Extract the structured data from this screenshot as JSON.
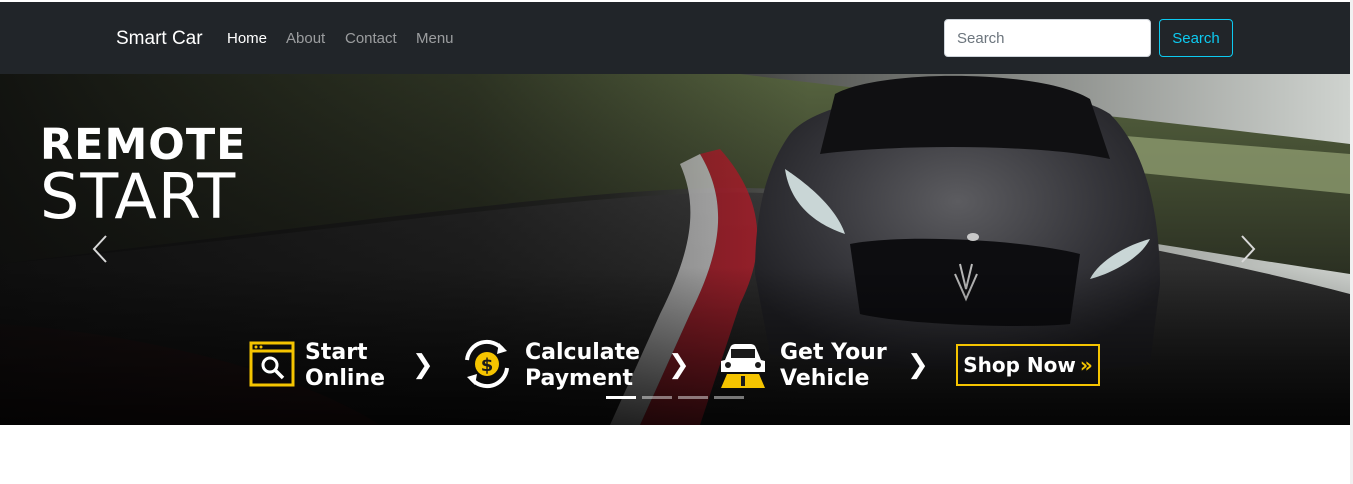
{
  "navbar": {
    "brand": "Smart Car",
    "links": [
      {
        "label": "Home",
        "active": true
      },
      {
        "label": "About",
        "active": false
      },
      {
        "label": "Contact",
        "active": false
      },
      {
        "label": "Menu",
        "active": false
      }
    ],
    "search": {
      "placeholder": "Search",
      "value": "",
      "button_label": "Search"
    }
  },
  "carousel": {
    "slide": {
      "headline_top": "REMOTE",
      "headline_bottom": "START",
      "steps": [
        {
          "line1": "Start",
          "line2": "Online",
          "icon": "browser-search-icon"
        },
        {
          "line1": "Calculate",
          "line2": "Payment",
          "icon": "dollar-cycle-icon"
        },
        {
          "line1": "Get Your",
          "line2": "Vehicle",
          "icon": "car-road-icon"
        }
      ],
      "separator": "❯",
      "cta_label": "Shop Now",
      "cta_chevron": "»"
    },
    "controls": {
      "prev": "‹",
      "next": "›"
    },
    "indicators": {
      "count": 4,
      "active_index": 0
    }
  },
  "colors": {
    "navbar_bg": "#212529",
    "accent_yellow": "#f5c400",
    "search_button": "#0dcaf0"
  }
}
